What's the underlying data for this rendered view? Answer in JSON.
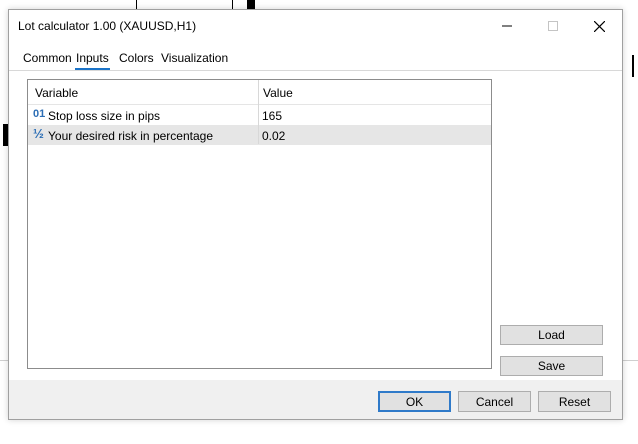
{
  "window": {
    "title": "Lot calculator 1.00 (XAUUSD,H1)",
    "minimize_icon": "minimize-icon",
    "maximize_icon": "maximize-icon",
    "close_icon": "close-icon"
  },
  "tabs": [
    {
      "label": "Common",
      "active": false
    },
    {
      "label": "Inputs",
      "active": true
    },
    {
      "label": "Colors",
      "active": false
    },
    {
      "label": "Visualization",
      "active": false
    }
  ],
  "grid": {
    "headers": {
      "variable": "Variable",
      "value": "Value"
    },
    "rows": [
      {
        "icon": "integer-icon",
        "icon_glyph": "01",
        "variable": "Stop loss size in pips",
        "value": "165"
      },
      {
        "icon": "fraction-icon",
        "icon_glyph": "½",
        "variable": "Your desired risk in percentage",
        "value": "0.02"
      }
    ]
  },
  "side_buttons": {
    "load": "Load",
    "save": "Save"
  },
  "footer_buttons": {
    "ok": "OK",
    "cancel": "Cancel",
    "reset": "Reset"
  },
  "colors": {
    "accent": "#2f7ac9",
    "tab_underline": "#1a73c8",
    "selected_row": "#e6e6e6"
  }
}
